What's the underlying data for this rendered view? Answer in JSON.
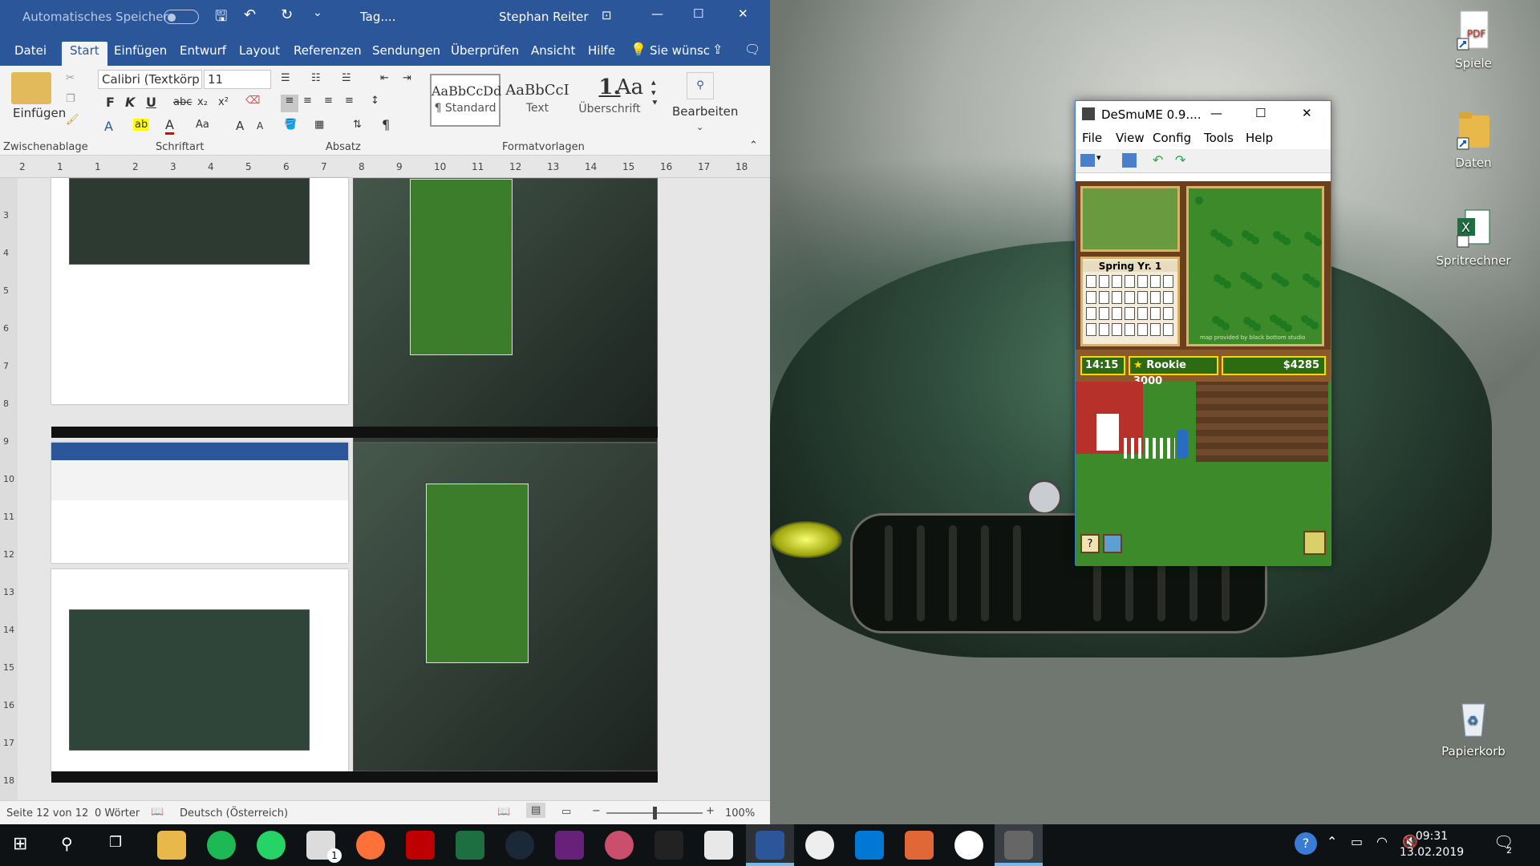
{
  "word": {
    "title_bar": {
      "autosave_label": "Automatisches Speichern",
      "doc_title": "Tag....",
      "user": "Stephan Reiter"
    },
    "tabs": [
      "Datei",
      "Start",
      "Einfügen",
      "Entwurf",
      "Layout",
      "Referenzen",
      "Sendungen",
      "Überprüfen",
      "Ansicht",
      "Hilfe",
      "Sie wünsc"
    ],
    "ribbon": {
      "paste_label": "Einfügen",
      "font_name": "Calibri (Textkörp",
      "font_size": "11",
      "bold": "F",
      "italic": "K",
      "underline": "U",
      "strike": "abc",
      "subscript": "x₂",
      "superscript": "x²",
      "case": "Aa",
      "grow_font": "A",
      "shrink_font": "A",
      "pilcrow": "¶",
      "styles": [
        {
          "sample": "AaBbCcDd",
          "name": "¶ Standard"
        },
        {
          "sample": "AaBbCcI",
          "name": "Text"
        },
        {
          "sample": "1.",
          "name": "Überschrift"
        },
        {
          "sample": "Aa",
          "name": ""
        }
      ],
      "edit_label": "Bearbeiten",
      "groups": [
        "Zwischenablage",
        "Schriftart",
        "Absatz",
        "Formatvorlagen"
      ]
    },
    "ruler_numbers": [
      "2",
      "1",
      "1",
      "2",
      "3",
      "4",
      "5",
      "6",
      "7",
      "8",
      "9",
      "10",
      "11",
      "12",
      "13",
      "14",
      "15",
      "16",
      "17",
      "18"
    ],
    "vruler_numbers": [
      "3",
      "4",
      "5",
      "6",
      "7",
      "8",
      "9",
      "10",
      "11",
      "12",
      "13",
      "14",
      "15",
      "16",
      "17",
      "18"
    ],
    "status": {
      "page": "Seite 12 von 12",
      "words": "0 Wörter",
      "language": "Deutsch (Österreich)",
      "zoom": "100%",
      "zoom_minus": "−",
      "zoom_plus": "+"
    }
  },
  "desmume": {
    "title": "DeSmuME 0.9....",
    "menu": [
      "File",
      "View",
      "Config",
      "Tools",
      "Help"
    ],
    "game": {
      "season": "Spring Yr. 1",
      "time": "14:15",
      "rank": "Rookie 3000",
      "money": "$4285",
      "map_credit": "map provided by black bottom studio"
    }
  },
  "desktop_icons": [
    {
      "label": "Spiele",
      "icon": "pdf-shortcut-icon"
    },
    {
      "label": "Daten",
      "icon": "folder-shortcut-icon"
    },
    {
      "label": "Spritrechner",
      "icon": "excel-shortcut-icon"
    },
    {
      "label": "Papierkorb",
      "icon": "recycle-bin-icon"
    }
  ],
  "taskbar": {
    "apps": [
      "start",
      "search",
      "task-view",
      "file-explorer",
      "spotify",
      "whatsapp",
      "mail",
      "firefox",
      "filezilla",
      "excel",
      "steam",
      "visual-studio",
      "app-paint",
      "app-inkscape",
      "calculator",
      "word",
      "app-unity-hub",
      "vscode",
      "matlab",
      "unity",
      "desmume"
    ],
    "mail_badge": "1",
    "time": "09:31",
    "date": "13.02.2019",
    "notif_count": "2"
  },
  "colors": {
    "word_blue": "#2b579a",
    "taskbar": "#0f1215",
    "hud_gold": "#ffd700"
  }
}
